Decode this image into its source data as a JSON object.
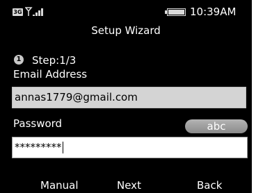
{
  "status_bar": {
    "network": "3G",
    "signal_icon": "signal-bars-icon",
    "battery_icon": "battery-icon",
    "time": "10:39AM"
  },
  "header": {
    "title": "Setup Wizard"
  },
  "step": {
    "badge": "1",
    "label": "Step:1/3"
  },
  "form": {
    "email_label": "Email Address",
    "email_value": "annas1779@gmail.com",
    "password_label": "Password",
    "password_value": "*********",
    "input_mode": "abc"
  },
  "softkeys": {
    "left": "Manual",
    "center": "Next",
    "right": "Back"
  },
  "colors": {
    "background": "#000000",
    "field_filled": "#d4d4d4",
    "field_active": "#ffffff",
    "pill": "#9e9e9e"
  }
}
